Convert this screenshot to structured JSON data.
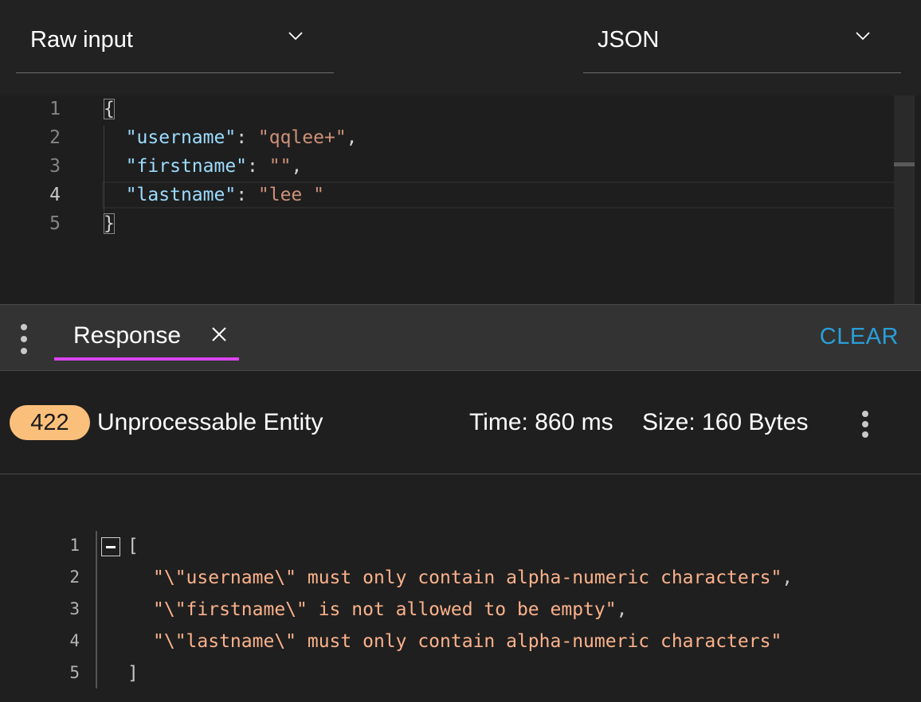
{
  "request": {
    "input_mode": "Raw input",
    "format": "JSON",
    "lines": [
      {
        "num": "1",
        "text": "{"
      },
      {
        "num": "2",
        "key": "\"username\"",
        "value": "\"qqlee+\"",
        "trail": ","
      },
      {
        "num": "3",
        "key": "\"firstname\"",
        "value": "\"\"",
        "trail": ","
      },
      {
        "num": "4",
        "key": "\"lastname\"",
        "value": "\"lee \"",
        "trail": ""
      },
      {
        "num": "5",
        "text": "}"
      }
    ]
  },
  "response": {
    "tab_label": "Response",
    "clear_label": "CLEAR",
    "status_code": "422",
    "status_text": "Unprocessable Entity",
    "time": "Time: 860 ms",
    "size": "Size: 160 Bytes",
    "lines": [
      {
        "num": "1",
        "text": "["
      },
      {
        "num": "2",
        "text": "\"\\\"username\\\" must only contain alpha-numeric characters\"",
        "trail": ","
      },
      {
        "num": "3",
        "text": "\"\\\"firstname\\\" is not allowed to be empty\"",
        "trail": ","
      },
      {
        "num": "4",
        "text": "\"\\\"lastname\\\" must only contain alpha-numeric characters\"",
        "trail": ""
      },
      {
        "num": "5",
        "text": "]"
      }
    ]
  },
  "colors": {
    "accent_tab": "#d946ef",
    "clear": "#2a9fd8",
    "badge": "#fbbf7c",
    "json_key": "#9cdcfe",
    "json_string": "#ce9178",
    "response_string": "#fbb28b"
  },
  "icons": [
    "chevron-down-icon",
    "close-icon",
    "kebab-menu-icon",
    "fold-collapse-icon"
  ]
}
